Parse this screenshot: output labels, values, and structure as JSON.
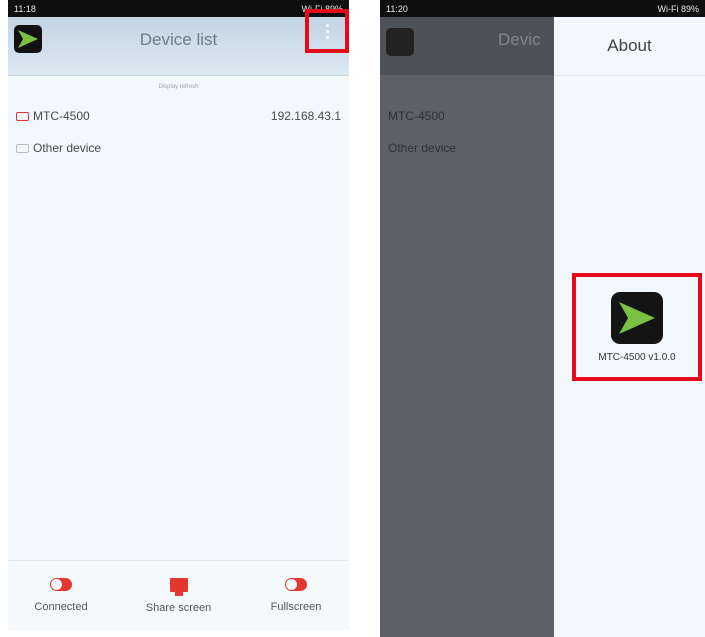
{
  "left_screen": {
    "status": {
      "time": "11:18",
      "right": "Wi-Fi 89%"
    },
    "title": "Device list",
    "hint": "Display refresh",
    "devices": [
      {
        "name": "MTC-4500",
        "ip": "192.168.43.1"
      },
      {
        "name": "Other device",
        "ip": ""
      }
    ],
    "bottom": [
      {
        "label": "Connected",
        "icon": "toggle-on-icon"
      },
      {
        "label": "Share screen",
        "icon": "share-screen-icon"
      },
      {
        "label": "Fullscreen",
        "icon": "toggle-on-icon"
      }
    ]
  },
  "right_screen": {
    "status": {
      "time": "11:20",
      "right": "Wi-Fi 89%"
    },
    "background_title": "Devic",
    "background_devices": [
      "MTC-4500",
      "Other device"
    ],
    "drawer_title": "About",
    "about_version": "MTC-4500 v1.0.0"
  },
  "colors": {
    "highlight": "#e6091a",
    "accent": "#e5372f",
    "logo_green": "#7bc043"
  }
}
